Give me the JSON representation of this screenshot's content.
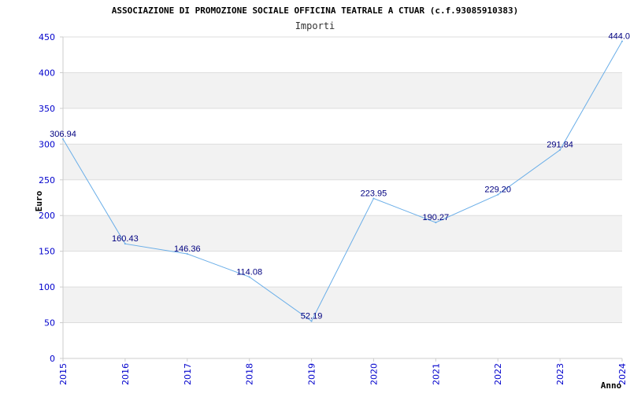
{
  "chart_data": {
    "type": "line",
    "title": "ASSOCIAZIONE DI PROMOZIONE SOCIALE OFFICINA TEATRALE A CTUAR (c.f.93085910383)",
    "subtitle": "Importi",
    "xlabel": "Anno",
    "ylabel": "Euro",
    "categories": [
      "2015",
      "2016",
      "2017",
      "2018",
      "2019",
      "2020",
      "2021",
      "2022",
      "2023",
      "2024"
    ],
    "values": [
      306.94,
      160.43,
      146.36,
      114.08,
      52.19,
      223.95,
      190.27,
      229.2,
      291.84,
      444.0
    ],
    "value_labels": [
      "306.94",
      "160.43",
      "146.36",
      "114.08",
      "52.19",
      "223.95",
      "190.27",
      "229.20",
      "291.84",
      "444.0"
    ],
    "yticks": [
      "0",
      "50",
      "100",
      "150",
      "200",
      "250",
      "300",
      "350",
      "400",
      "450"
    ],
    "ylim": [
      0,
      450
    ],
    "grid": true,
    "legend": "none",
    "colors": {
      "line": "#6aaee8",
      "tick_text": "#0000cc",
      "value_text": "#000080",
      "band": "#f2f2f2",
      "gridline": "#dddddd",
      "axis": "#cccccc"
    }
  }
}
